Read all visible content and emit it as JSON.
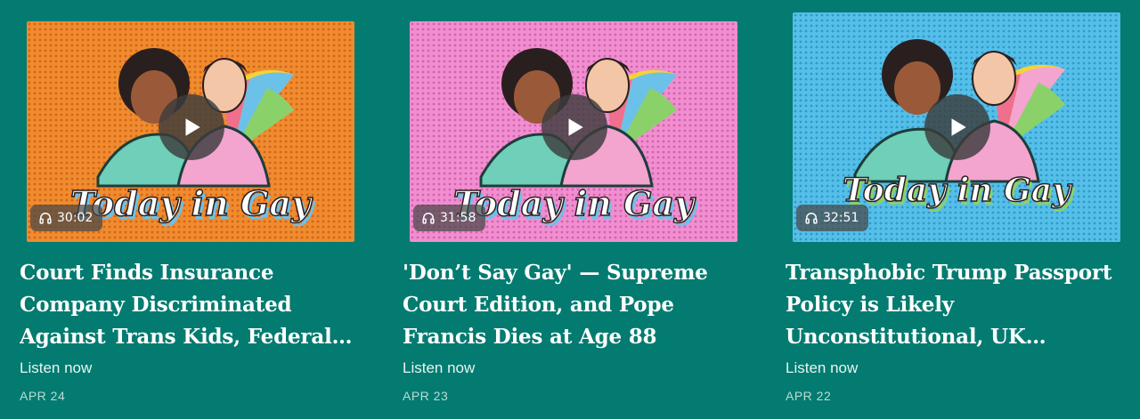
{
  "episodes": [
    {
      "title_lines": [
        "Court Finds Insurance",
        "Company Discriminated",
        "Against Trans Kids, Federal…"
      ],
      "duration": "30:02",
      "listen": "Listen now",
      "date": "APR 24",
      "thumb_text": "Today in Gay",
      "bg_color": "#ee8c2e",
      "dot_color": "#d9601e"
    },
    {
      "title_lines": [
        "'Don’t Say Gay' — Supreme",
        "Court Edition, and Pope",
        "Francis Dies at Age 88"
      ],
      "duration": "31:58",
      "listen": "Listen now",
      "date": "APR 23",
      "thumb_text": "Today in Gay",
      "bg_color": "#f08fcf",
      "dot_color": "#d660b2"
    },
    {
      "title_lines": [
        "Transphobic Trump Passport",
        "Policy is Likely",
        "Unconstitutional, UK…"
      ],
      "duration": "32:51",
      "listen": "Listen now",
      "date": "APR 22",
      "thumb_text": "Today in Gay",
      "bg_color": "#56bfe8",
      "dot_color": "#2f9ad0"
    }
  ],
  "icons": {
    "play": "play-icon",
    "duration": "headphones-icon"
  },
  "colors": {
    "page_bg": "#037b70",
    "text": "#ffffff"
  }
}
